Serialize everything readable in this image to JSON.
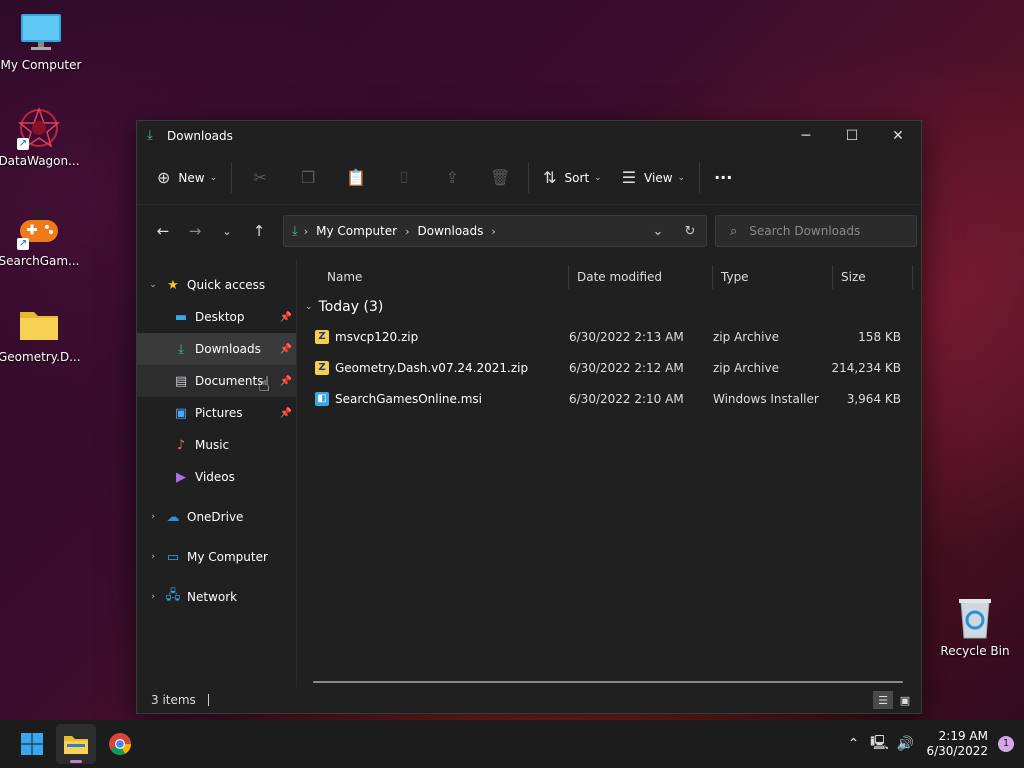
{
  "desktop": {
    "icons": [
      {
        "label": "My Computer"
      },
      {
        "label": "DataWagon..."
      },
      {
        "label": "SearchGam..."
      },
      {
        "label": "Geometry.D..."
      },
      {
        "label": "Recycle Bin"
      }
    ]
  },
  "window": {
    "title": "Downloads",
    "controls": {
      "minimize": "─",
      "maximize": "☐",
      "close": "✕"
    }
  },
  "toolbar": {
    "new_label": "New",
    "sort_label": "Sort",
    "view_label": "View",
    "more_label": "···"
  },
  "address": {
    "crumbs": [
      "My Computer",
      "Downloads"
    ]
  },
  "search": {
    "placeholder": "Search Downloads"
  },
  "sidebar": {
    "quick_access": "Quick access",
    "items": [
      {
        "label": "Desktop"
      },
      {
        "label": "Downloads"
      },
      {
        "label": "Documents"
      },
      {
        "label": "Pictures"
      },
      {
        "label": "Music"
      },
      {
        "label": "Videos"
      }
    ],
    "onedrive": "OneDrive",
    "my_computer": "My Computer",
    "network": "Network"
  },
  "columns": {
    "name": "Name",
    "date": "Date modified",
    "type": "Type",
    "size": "Size"
  },
  "group": {
    "label": "Today (3)"
  },
  "files": [
    {
      "name": "msvcp120.zip",
      "date": "6/30/2022 2:13 AM",
      "type": "zip Archive",
      "size": "158 KB"
    },
    {
      "name": "Geometry.Dash.v07.24.2021.zip",
      "date": "6/30/2022 2:12 AM",
      "type": "zip Archive",
      "size": "214,234 KB"
    },
    {
      "name": "SearchGamesOnline.msi",
      "date": "6/30/2022 2:10 AM",
      "type": "Windows Installer ...",
      "size": "3,964 KB"
    }
  ],
  "status": {
    "count": "3 items"
  },
  "taskbar": {
    "time": "2:19 AM",
    "date": "6/30/2022",
    "notification_count": "1"
  }
}
